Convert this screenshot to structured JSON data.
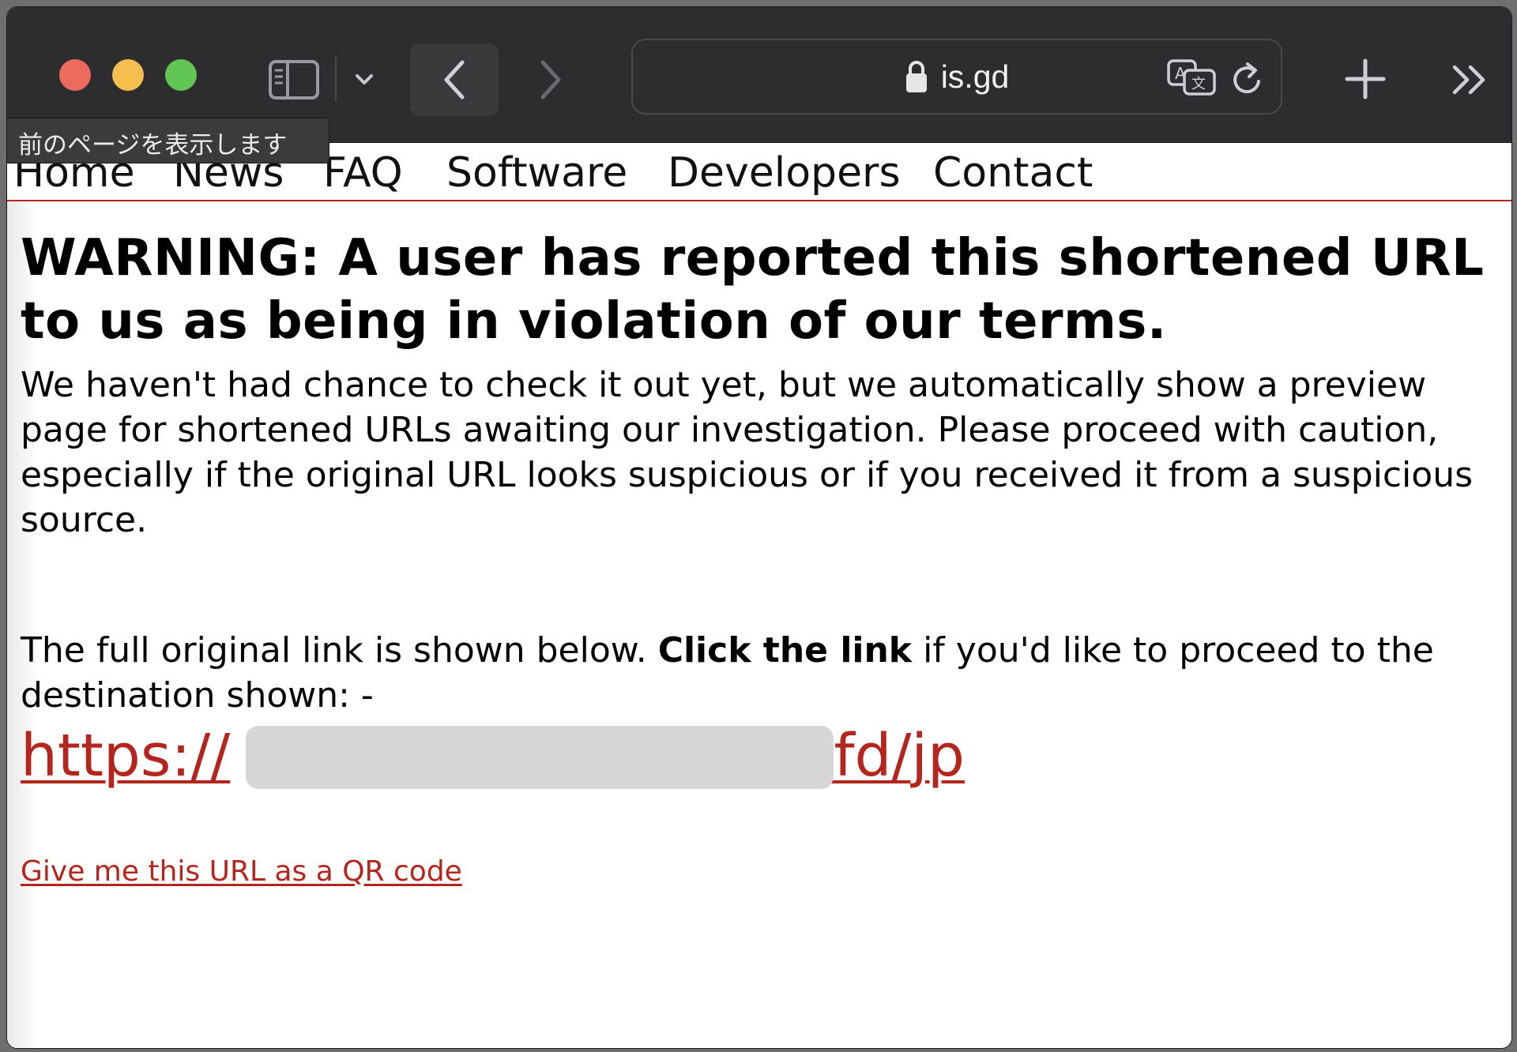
{
  "browser": {
    "address": "is.gd",
    "tooltip": "前のページを表示します",
    "icons": {
      "close": "traffic-light-red",
      "minimize": "traffic-light-yellow",
      "zoom": "traffic-light-green",
      "sidebar": "sidebar-icon",
      "sidebar_menu": "chevron-down-icon",
      "back": "chevron-left-icon",
      "forward": "chevron-right-icon",
      "lock": "lock-icon",
      "translate": "translate-icon",
      "reload": "reload-icon",
      "new_tab": "plus-icon",
      "overflow": "double-chevron-right-icon"
    }
  },
  "nav": {
    "items": [
      "Home",
      "News",
      "FAQ",
      "Software",
      "Developers",
      "Contact"
    ]
  },
  "page": {
    "warning_title": "WARNING: A user has reported this shortened URL to us as being in violation of our terms.",
    "explanation": "We haven't had chance to check it out yet, but we automatically show a preview page for shortened URLs awaiting our investigation. Please proceed with caution, especially if the original URL looks suspicious or if you received it from a suspicious source.",
    "instruction_before": "The full original link is shown below.",
    "instruction_bold": "Click the link",
    "instruction_after": "if you'd like to proceed to the destination shown: -",
    "destination_start": "https://",
    "destination_end": ".cfd/jp",
    "qr_link": "Give me this URL as a QR code"
  },
  "colors": {
    "link": "#b3261e",
    "toolbar": "#2d2d2f",
    "nav_border": "#b3261e"
  }
}
